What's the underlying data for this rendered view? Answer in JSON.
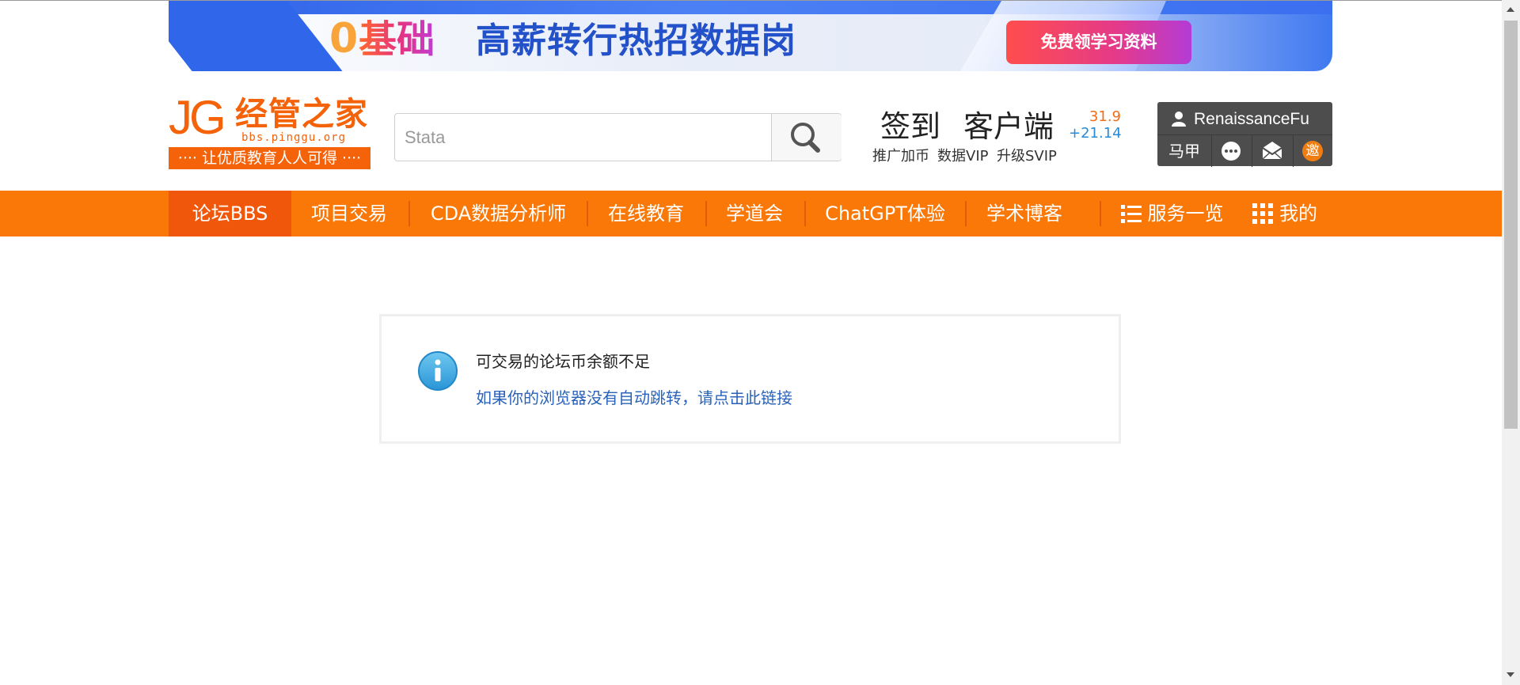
{
  "banner": {
    "zero": "0",
    "jichu": "基础",
    "slogan": "高薪转行热招数据岗",
    "cta": "免费领学习资料"
  },
  "logo": {
    "jg": "JG",
    "cn": "经管之家",
    "url": "bbs.pinggu.org",
    "tagline": "···· 让优质教育人人可得 ····"
  },
  "search": {
    "placeholder": "Stata",
    "button_icon": "search-icon"
  },
  "quick_links": {
    "checkin": "签到",
    "client": "客户端",
    "promote": "推广加币",
    "data_vip": "数据VIP",
    "upgrade_svip": "升级SVIP"
  },
  "scores": {
    "total": "31.9",
    "delta": "+21.14"
  },
  "user": {
    "username": "RenaissanceFu",
    "majia": "马甲",
    "invite": "邀",
    "icons": [
      "user-icon",
      "chat-icon",
      "mail-icon",
      "invite-icon"
    ]
  },
  "nav": {
    "items": [
      {
        "label": "论坛BBS"
      },
      {
        "label": "项目交易"
      },
      {
        "label": "CDA数据分析师"
      },
      {
        "label": "在线教育"
      },
      {
        "label": "学道会"
      },
      {
        "label": "ChatGPT体验"
      },
      {
        "label": "学术博客"
      },
      {
        "label": "服务一览"
      },
      {
        "label": "我的"
      }
    ]
  },
  "message": {
    "title": "可交易的论坛币余额不足",
    "redirect_link": "如果你的浏览器没有自动跳转，请点击此链接"
  },
  "colors": {
    "nav_bg": "#f97807",
    "nav_active": "#f0570a",
    "brand_orange": "#f4620a",
    "link_blue": "#2a62b8",
    "info_blue": "#38a8e2"
  }
}
